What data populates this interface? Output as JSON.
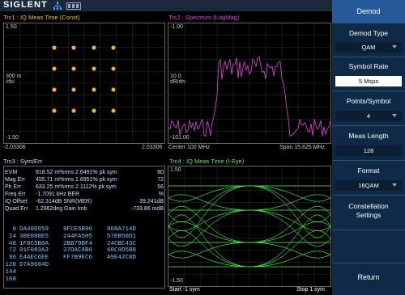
{
  "brand": "SIGLENT",
  "topbar_icons": [
    "network-icon",
    "battery-icon"
  ],
  "trc1": {
    "title": "Trc1 : IQ Meas Time (Const)",
    "y_top": "1.50",
    "y_mid": "300 m /div",
    "y_bot": "-1.50",
    "x_left": "-2.03306",
    "x_right": "2.03306"
  },
  "trc2": {
    "title": "Trc2 : Spectrum (LogMag)",
    "y_top": "-1.00",
    "y_mid": "10.0\ndB/div",
    "y_bot": "-101.00",
    "x_left": "Center 100 MHz",
    "x_right": "Span 15.625 MHz"
  },
  "trc3": {
    "title": "Trc3 : Sym/Err",
    "metrics": [
      {
        "label": "EVM",
        "value": "818.52 m%rms 2.6491% pk sym",
        "extra": "80"
      },
      {
        "label": "Mag Err",
        "value": "455.71 m%rms 1.6951% pk sym",
        "extra": "72"
      },
      {
        "label": "Ph Err",
        "value": "633.25 m%rms 2.1112% pk sym",
        "extra": "56"
      },
      {
        "label": "Freq Err",
        "value": "-1.7091 kHz BER",
        "extra": "%"
      },
      {
        "label": "IQ Offset",
        "value": "-62.314dB SNR(MER)",
        "extra": "39.241dB"
      },
      {
        "label": "Quad Err",
        "value": "1.2962deg Gain Imb",
        "extra": "-733.86 mdB"
      }
    ],
    "symbols": [
      {
        "idx": "0",
        "c1": "DA40D959",
        "c2": "9FCE6B96",
        "c3": "808A714D"
      },
      {
        "idx": "24",
        "c1": "30E088E5",
        "c2": "244FA505",
        "c3": "57EB50D1"
      },
      {
        "idx": "48",
        "c1": "1F8C5B0A",
        "c2": "2BB79BF4",
        "c3": "24CBC43C"
      },
      {
        "idx": "72",
        "c1": "01F083A3",
        "c2": "37DAC4B6",
        "c3": "60C9D5B8"
      },
      {
        "idx": "96",
        "c1": "E4AEC6EE",
        "c2": "FF7B9EC6",
        "c3": "A9E42C8D"
      },
      {
        "idx": "120",
        "c1": "D7A9604D",
        "c2": "",
        "c3": ""
      },
      {
        "idx": "144",
        "c1": "",
        "c2": "",
        "c3": ""
      },
      {
        "idx": "168",
        "c1": "",
        "c2": "",
        "c3": ""
      }
    ]
  },
  "trc4": {
    "title": "Trc4 : IQ Meas Time (I-Eye)",
    "y_top": "1.50",
    "y_bot": "-1.50",
    "x_left": "Start -1 sym",
    "x_right": "Stop 1 sym"
  },
  "menu": {
    "header": "Demod",
    "demod_type_label": "Demod Type",
    "demod_type_value": "QAM",
    "symbol_rate_label": "Symbol Rate",
    "symbol_rate_value": "5 Msps",
    "points_label": "Points/Symbol",
    "points_value": "4",
    "meas_length_label": "Meas Length",
    "meas_length_value": "128",
    "format_label": "Format",
    "format_value": "16QAM",
    "constellation_label": "Constellation\nSettings",
    "return_label": "Return"
  },
  "colors": {
    "trace_yellow": "#e6c23a",
    "trace_magenta": "#d040d0",
    "trace_green": "#3fe03f",
    "menu_bg": "#0f2a47"
  }
}
